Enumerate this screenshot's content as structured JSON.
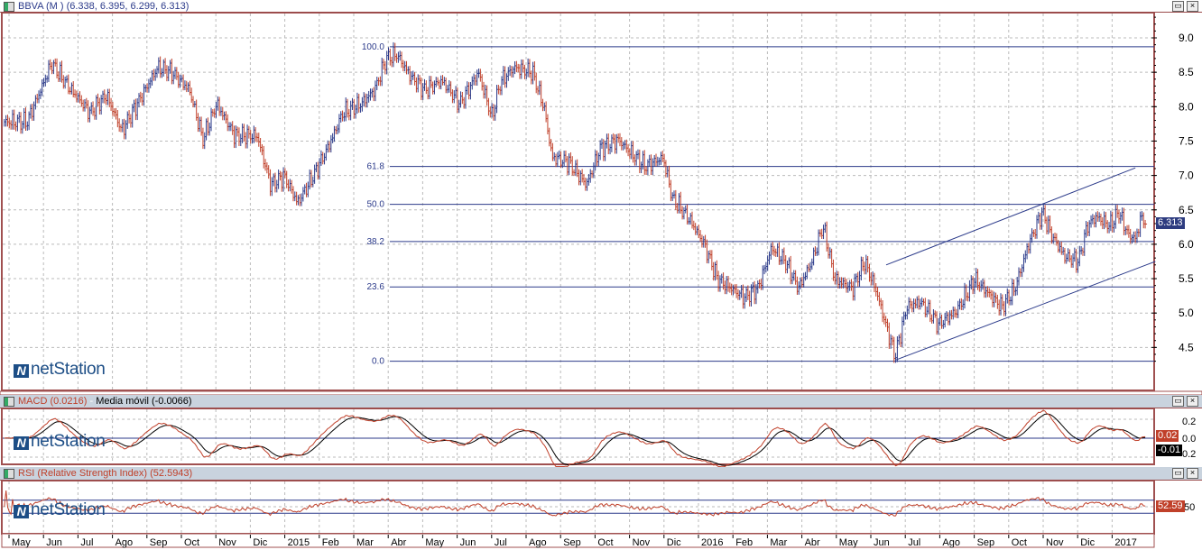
{
  "header": {
    "title": "BBVA (M ) (6.338, 6.395, 6.299, 6.313)",
    "restore": "▭",
    "close": "×"
  },
  "macd_header": {
    "macd": "MACD (0.0216)",
    "sep": " - ",
    "signal": "Media móvil (-0.0066)"
  },
  "rsi_header": {
    "title": "RSI (Relative Strength Index) (52.5943)"
  },
  "logo": "netStation",
  "readouts": {
    "price": "6.313",
    "macd": "0.02",
    "signal": "-0.01",
    "rsi": "52.59"
  },
  "colors": {
    "up": "#2b3a8a",
    "down": "#c0402a",
    "fib": "#2b3a8a",
    "frame": "#a05050",
    "macd": "#c0402a",
    "signal": "#000000",
    "rsi": "#c0402a"
  },
  "chart_data": {
    "type": "ohlc",
    "title": "BBVA (M )",
    "time_unit": "months since May 2014",
    "x_ticks": [
      "May",
      "Jun",
      "Jul",
      "Ago",
      "Sep",
      "Oct",
      "Nov",
      "Dic",
      "2015",
      "Feb",
      "Mar",
      "Abr",
      "May",
      "Jun",
      "Jul",
      "Ago",
      "Sep",
      "Oct",
      "Nov",
      "Dic",
      "2016",
      "Feb",
      "Mar",
      "Abr",
      "May",
      "Jun",
      "Jul",
      "Ago",
      "Sep",
      "Oct",
      "Nov",
      "Dic",
      "2017"
    ],
    "y_ticks": [
      "9.0",
      "8.5",
      "8.0",
      "7.5",
      "7.0",
      "6.5",
      "6.0",
      "5.5",
      "5.0",
      "4.5"
    ],
    "ylim": [
      4.2,
      9.35
    ],
    "last": {
      "open": 6.338,
      "high": 6.395,
      "low": 6.299,
      "close": 6.313
    },
    "price": {
      "t": [
        -0.24,
        0.42,
        0.81,
        1.13,
        1.6,
        2.25,
        2.72,
        3.17,
        3.69,
        4.21,
        4.61,
        5.13,
        5.52,
        5.92,
        6.44,
        7.09,
        7.49,
        7.88,
        8.27,
        8.8,
        9.19,
        9.58,
        10.1,
        10.5,
        10.84,
        11.15,
        11.54,
        11.94,
        12.46,
        12.98,
        13.51,
        13.9,
        14.16,
        14.55,
        15.08,
        15.42,
        15.65,
        16.13,
        16.65,
        17.04,
        17.57,
        17.96,
        18.35,
        18.87,
        19.14,
        19.66,
        20.05,
        20.45,
        20.84,
        21.23,
        21.62,
        22.02,
        22.41,
        22.8,
        23.19,
        23.51,
        23.85,
        24.37,
        24.71,
        25.03,
        25.29,
        25.6,
        25.94,
        26.34,
        26.86,
        27.38,
        27.91,
        28.3,
        28.69,
        29.08,
        29.48,
        29.87,
        30.13,
        30.52,
        30.92,
        31.18,
        31.44,
        31.83,
        32.09,
        32.36,
        32.57,
        32.75,
        32.88
      ],
      "close": [
        7.78,
        7.78,
        8.24,
        8.63,
        8.3,
        7.91,
        8.17,
        7.65,
        8.11,
        8.57,
        8.5,
        8.24,
        7.52,
        8.04,
        7.58,
        7.58,
        6.86,
        6.99,
        6.6,
        7.06,
        7.45,
        7.91,
        8.04,
        8.24,
        8.7,
        8.76,
        8.44,
        8.24,
        8.37,
        8.04,
        8.5,
        7.85,
        8.37,
        8.57,
        8.5,
        7.98,
        7.26,
        7.19,
        6.86,
        7.39,
        7.52,
        7.32,
        7.13,
        7.26,
        6.67,
        6.34,
        6.01,
        5.49,
        5.36,
        5.23,
        5.36,
        5.95,
        5.75,
        5.36,
        5.75,
        6.27,
        5.49,
        5.36,
        5.75,
        5.36,
        4.9,
        4.37,
        5.09,
        5.16,
        4.83,
        5.03,
        5.49,
        5.29,
        5.09,
        5.36,
        6.01,
        6.47,
        6.14,
        5.82,
        5.75,
        6.27,
        6.4,
        6.27,
        6.47,
        6.14,
        6.08,
        6.4,
        6.31
      ]
    },
    "fibonacci": {
      "start_t": 10.94,
      "levels": [
        {
          "label": "100.0",
          "value": 8.87
        },
        {
          "label": "61.8",
          "value": 7.13
        },
        {
          "label": "50.0",
          "value": 6.58
        },
        {
          "label": "38.2",
          "value": 6.04
        },
        {
          "label": "23.6",
          "value": 5.38
        },
        {
          "label": "0.0",
          "value": 4.3
        }
      ]
    },
    "channel": [
      {
        "name": "upper",
        "from": [
          25.34,
          5.7
        ],
        "to": [
          32.57,
          7.11
        ]
      },
      {
        "name": "lower",
        "from": [
          25.63,
          4.32
        ],
        "to": [
          33.15,
          5.75
        ]
      }
    ],
    "macd": {
      "y_ticks": [
        "0.2",
        "0.0",
        "0.2"
      ],
      "ylim": [
        -0.3,
        0.3
      ]
    },
    "rsi": {
      "y_ticks": [
        "50"
      ],
      "bands": [
        70,
        30
      ],
      "ylim": [
        0,
        100
      ]
    }
  }
}
